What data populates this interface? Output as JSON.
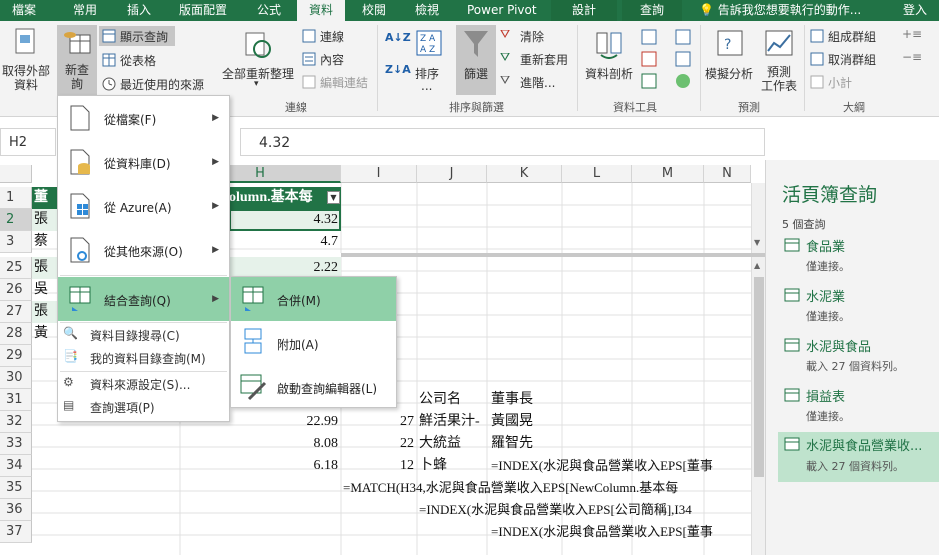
{
  "tabs": [
    "檔案",
    "常用",
    "插入",
    "版面配置",
    "公式",
    "資料",
    "校閱",
    "檢視",
    "Power Pivot",
    "設計",
    "查詢"
  ],
  "tell_me": "告訴我您想要執行的動作...",
  "sign_in": "登入",
  "ribbon": {
    "get_external": "取得外部\n資料",
    "new_query": "新查\n詢",
    "show_queries": "顯示查詢",
    "from_table": "從表格",
    "recent_sources": "最近使用的來源",
    "refresh_all": "全部重新整理",
    "connections": "連線",
    "properties": "內容",
    "edit_links": "編輯連結",
    "group_connections": "連線",
    "sort": "排序",
    "sort_sub": "...",
    "filter": "篩選",
    "clear": "清除",
    "reapply": "重新套用",
    "advanced": "進階...",
    "group_sort": "排序與篩選",
    "text_to_columns": "資料剖析",
    "group_data_tools": "資料工具",
    "what_if": "模擬分析",
    "forecast_sheet": "預測\n工作表",
    "group_forecast": "預測",
    "group": "組成群組",
    "ungroup": "取消群組",
    "subtotal": "小計",
    "group_outline": "大綱"
  },
  "name_box": "H2",
  "formula": "4.32",
  "columns": [
    "H",
    "I",
    "J",
    "K",
    "L",
    "M",
    "N"
  ],
  "rows": [
    "1",
    "2",
    "3",
    "25",
    "26",
    "27",
    "28",
    "29",
    "30",
    "31",
    "32",
    "33",
    "34",
    "35",
    "36",
    "37"
  ],
  "cells": {
    "a1": "董",
    "a2": "張",
    "a3": "蔡",
    "a25": "張",
    "a26": "吳",
    "a27": "張",
    "a28": "黃",
    "h1": "olumn.基本每",
    "h2": "4.32",
    "h3": "4.7",
    "h25": "2.22",
    "j31": "公司名",
    "k31": "董事長",
    "h32": "22.99",
    "i32": "27",
    "j32": "鮮活果汁-",
    "k32": "黃國晃",
    "h33": "8.08",
    "i33": "22",
    "j33": "大統益",
    "k33": "羅智先",
    "h34": "6.18",
    "i34": "12",
    "j34": "卜蜂",
    "k34": "=INDEX(水泥與食品營業收入EPS[董事",
    "h35": "=MATCH(H34,水泥與食品營業收入EPS[NewColumn.基本每",
    "j36": "=INDEX(水泥與食品營業收入EPS[公司簡稱],I34",
    "k37": "=INDEX(水泥與食品營業收入EPS[董事"
  },
  "menu": [
    {
      "label": "從檔案(F)",
      "arrow": "▶"
    },
    {
      "label": "從資料庫(D)",
      "arrow": "▶"
    },
    {
      "label": "從 Azure(A)",
      "arrow": "▶"
    },
    {
      "label": "從其他來源(O)",
      "arrow": "▶"
    },
    {
      "label": "結合查詢(Q)",
      "arrow": "▶"
    },
    {
      "label": "資料目錄搜尋(C)"
    },
    {
      "label": "我的資料目錄查詢(M)"
    },
    {
      "label": "資料來源設定(S)..."
    },
    {
      "label": "查詢選項(P)"
    }
  ],
  "submenu": [
    {
      "label": "合併(M)"
    },
    {
      "label": "附加(A)"
    },
    {
      "label": "啟動查詢編輯器(L)"
    }
  ],
  "pane": {
    "title": "活頁簿查詢",
    "count": "5 個查詢",
    "queries": [
      {
        "name": "食品業",
        "desc": "僅連接。"
      },
      {
        "name": "水泥業",
        "desc": "僅連接。"
      },
      {
        "name": "水泥與食品",
        "desc": "載入 27 個資料列。"
      },
      {
        "name": "損益表",
        "desc": "僅連接。"
      },
      {
        "name": "水泥與食品營業收...",
        "desc": "載入 27 個資料列。"
      }
    ]
  },
  "colors": {
    "accent": "#217346",
    "selected": "#8fd0a8",
    "highlight": "#bfe3cd"
  }
}
